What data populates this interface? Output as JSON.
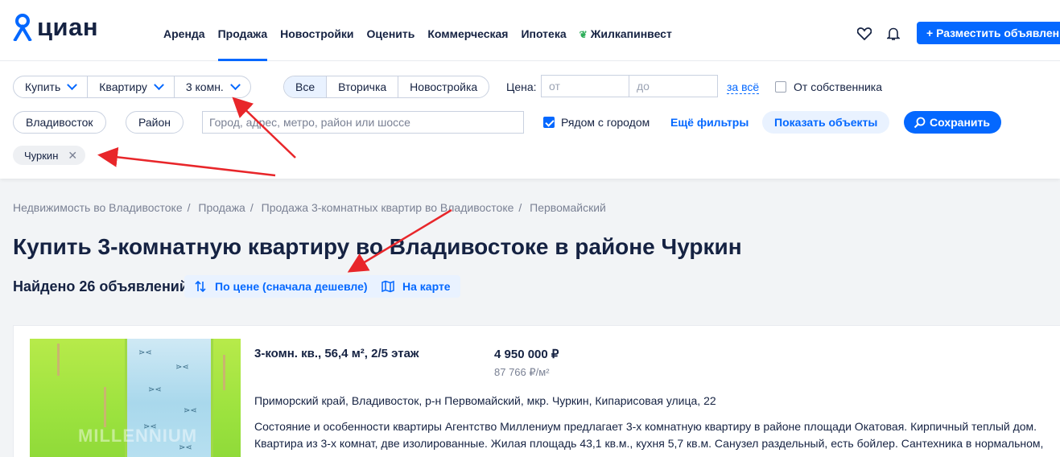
{
  "logo": {
    "text": "циан"
  },
  "nav": [
    {
      "label": "Аренда"
    },
    {
      "label": "Продажа",
      "active": true
    },
    {
      "label": "Новостройки"
    },
    {
      "label": "Оценить"
    },
    {
      "label": "Коммерческая"
    },
    {
      "label": "Ипотека"
    },
    {
      "label": "Жилкапинвест",
      "icon": "leaf-icon"
    }
  ],
  "header_actions": {
    "favorites_icon": "heart-icon",
    "notifications_icon": "bell-icon",
    "place_button": "+ Разместить объявление"
  },
  "filters": {
    "deal_type": "Купить",
    "object_type": "Квартиру",
    "rooms": "3 комн.",
    "market": [
      "Все",
      "Вторичка",
      "Новостройка"
    ],
    "market_selected": "Все",
    "price_label": "Цена:",
    "price_from_placeholder": "от",
    "price_to_placeholder": "до",
    "price_per_total": "за всё",
    "owner_only": {
      "label": "От собственника",
      "checked": false
    },
    "city": "Владивосток",
    "district": "Район",
    "search_placeholder": "Город, адрес, метро, район или шоссе",
    "near_city": {
      "label": "Рядом с городом",
      "checked": true
    },
    "more_filters": "Ещё фильтры",
    "show_button": "Показать объекты",
    "save_button": "Сохранить",
    "tag": "Чуркин"
  },
  "breadcrumb": [
    "Недвижимость во Владивостоке",
    "Продажа",
    "Продажа 3-комнатных квартир во Владивостоке",
    "Первомайский"
  ],
  "page_title": "Купить 3-комнатную квартиру во Владивостоке в районе Чуркин",
  "results": {
    "found": "Найдено 26 объявлений",
    "sort": "По цене (сначала дешевле)",
    "map": "На карте"
  },
  "listing": {
    "title": "3-комн. кв., 56,4 м², 2/5 этаж",
    "price": "4 950 000 ₽",
    "price_per_m2": "87 766 ₽/м²",
    "address": "Приморский край, Владивосток, р-н Первомайский, мкр. Чуркин, Кипарисовая улица, 22",
    "description": "Состояние и особенности квартиры Агентство Миллениум предлагает 3-х комнатную квартиру в районе площади Окатовая. Кирпичный теплый дом. Квартира из 3-х комнат, две изолированные. Жилая площадь 43,1 кв.м., кухня 5,7 кв.м. Санузел раздельный, есть бойлер. Сантехника в нормальном,",
    "photo_watermark": "MILLENNIUM"
  },
  "colors": {
    "accent": "#0468ff",
    "annotation": "#e8262a",
    "text": "#152242"
  }
}
